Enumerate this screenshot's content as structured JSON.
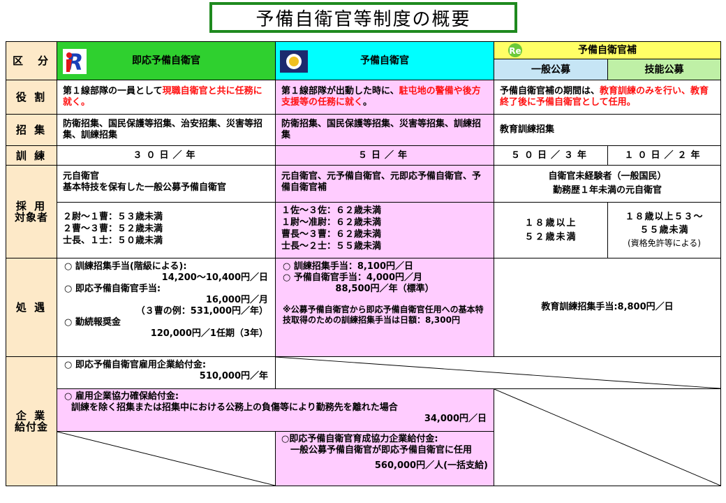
{
  "title": "予備自衛官等制度の概要",
  "header": {
    "kubun": "区　分",
    "sokuou": "即応予備自衛官",
    "yobi": "予備自衛官",
    "yobiho": "予備自衛官補",
    "ippan": "一般公募",
    "gino": "技能公募"
  },
  "rows": {
    "yakuwari": {
      "label": "役 割",
      "sokuou_a": "第１線部隊の一員として",
      "sokuou_b": "現職自衛官と共に任務に就く。",
      "yobi_a": "第１線部隊が出動した時に、",
      "yobi_b": "駐屯地の警備や後方支援等の任務に就く",
      "yobi_c": "。",
      "yobiho_a": "予備自衛官補の期間は、",
      "yobiho_b": "教育訓練のみを行い、教育終了後に予備自衛官として任用。"
    },
    "shoshu": {
      "label": "招 集",
      "sokuou": "防衛招集、国民保護等招集、治安招集、災害等招集、訓練招集",
      "yobi": "防衛招集、国民保護等招集、災害等招集、訓練招集",
      "yobiho": "教育訓練招集"
    },
    "kunren": {
      "label": "訓 練",
      "sokuou": "３０日／年",
      "yobi": "５日／年",
      "ippan": "５０日／３年",
      "gino": "１０日／２年"
    },
    "saiyo": {
      "label_a": "採 用",
      "label_b": "対象者",
      "sokuou_top_a": "元自衛官",
      "sokuou_top_b": "基本特技を保有した一般公募予備自衛官",
      "yobi_top": "元自衛官、元予備自衛官、元即応予備自衛官、予備自衛官補",
      "yobiho_top_a": "自衛官未経験者（一般国民）",
      "yobiho_top_b": "勤務歴１年未満の元自衛官",
      "sokuou_ages": [
        "２尉～１曹：５３歳未満",
        "２曹～３曹：５２歳未満",
        "士長、１士：５０歳未満"
      ],
      "yobi_ages": [
        "１佐～３佐：６２歳未満",
        "１尉～准尉：６２歳未満",
        "曹長～３曹：６２歳未満",
        "士長～２士：５５歳未満"
      ],
      "ippan_ages": [
        "１８歳以上",
        "５２歳未満"
      ],
      "gino_ages": [
        "１８歳以上５３～",
        "５５歳未満"
      ],
      "gino_note": "(資格免許等による)"
    },
    "shogu": {
      "label": "処 遇",
      "sokuou_1": "○ 訓練招集手当(階級による):",
      "sokuou_1v": "14,200～10,400円／日",
      "sokuou_2": "○ 即応予備自衛官手当:",
      "sokuou_2v": "16,000円／月",
      "sokuou_2e": "（３曹の例：531,000円／年）",
      "sokuou_3": "○ 勤続報奨金",
      "sokuou_3v": "120,000円／1任期（3年）",
      "yobi_1": "○ 訓練招集手当：8,100円／日",
      "yobi_2": "○ 予備自衛官手当：4,000円／月",
      "yobi_2v": "88,500円／年（標準）",
      "yobi_note": "※公募予備自衛官から即応予備自衛官任用への基本特技取得のための訓練招集手当は日額：8,300円",
      "yobiho": "教育訓練招集手当:8,800円／日"
    },
    "kigyo": {
      "label_a": "企 業",
      "label_b": "給付金",
      "koyo": "○ 即応予備自衛官雇用企業給付金:",
      "koyo_v": "510,000円／年",
      "kyoryoku": "○ 雇用企業協力確保給付金:",
      "kyoryoku_d": "訓練を除く招集または招集中における公務上の負傷等により勤務先を離れた場合",
      "kyoryoku_v": "34,000円／日",
      "ikusei": "○即応予備自衛官育成協力企業給付金:",
      "ikusei_d": "一般公募予備自衛官が即応予備自衛官に任用",
      "ikusei_v": "560,000円／人(一括支給)"
    }
  },
  "colors": {
    "title_border": "#1f8a1f",
    "label_bg": "#fde9c8",
    "sokuou_bg": "#2fd02f",
    "yobi_bg": "#00ffff",
    "yobiho_bg": "#ffff66",
    "pink": "#ffccff",
    "accent_red": "#ff1111"
  }
}
